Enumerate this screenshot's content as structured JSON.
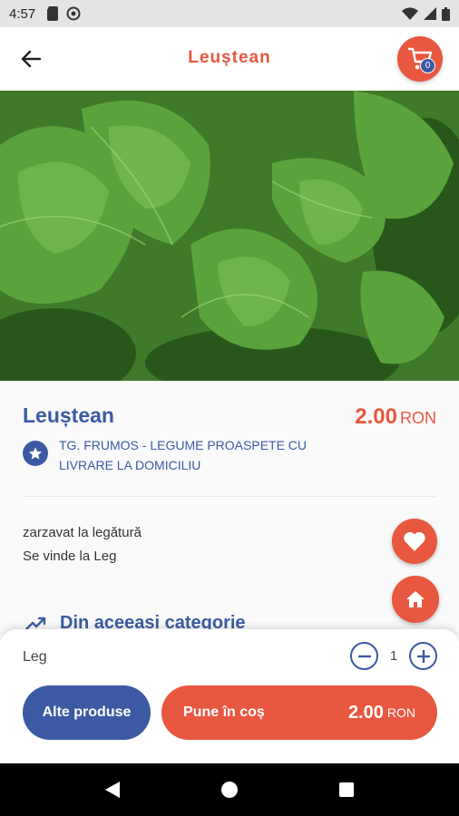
{
  "status_bar": {
    "time": "4:57"
  },
  "app_bar": {
    "title": "Leuștean",
    "cart_count": "0"
  },
  "product": {
    "name": "Leuștean",
    "price": "2.00",
    "currency": "RON",
    "seller": "TG. FRUMOS - LEGUME PROASPETE CU LIVRARE LA DOMICILIU",
    "description": [
      "zarzavat la legătură",
      "Se vinde la Leg"
    ],
    "same_category": "Din aceeasi categorie"
  },
  "order": {
    "unit": "Leg",
    "quantity": "1",
    "other_products_label": "Alte produse",
    "add_to_cart_label": "Pune în coș",
    "total": "2.00",
    "currency": "RON"
  },
  "colors": {
    "accent": "#e8573f",
    "primary": "#3b5aa3"
  },
  "icons": [
    "back-arrow-icon",
    "cart-icon",
    "star-icon",
    "heart-icon",
    "home-icon",
    "trending-icon",
    "minus-icon",
    "plus-icon"
  ]
}
